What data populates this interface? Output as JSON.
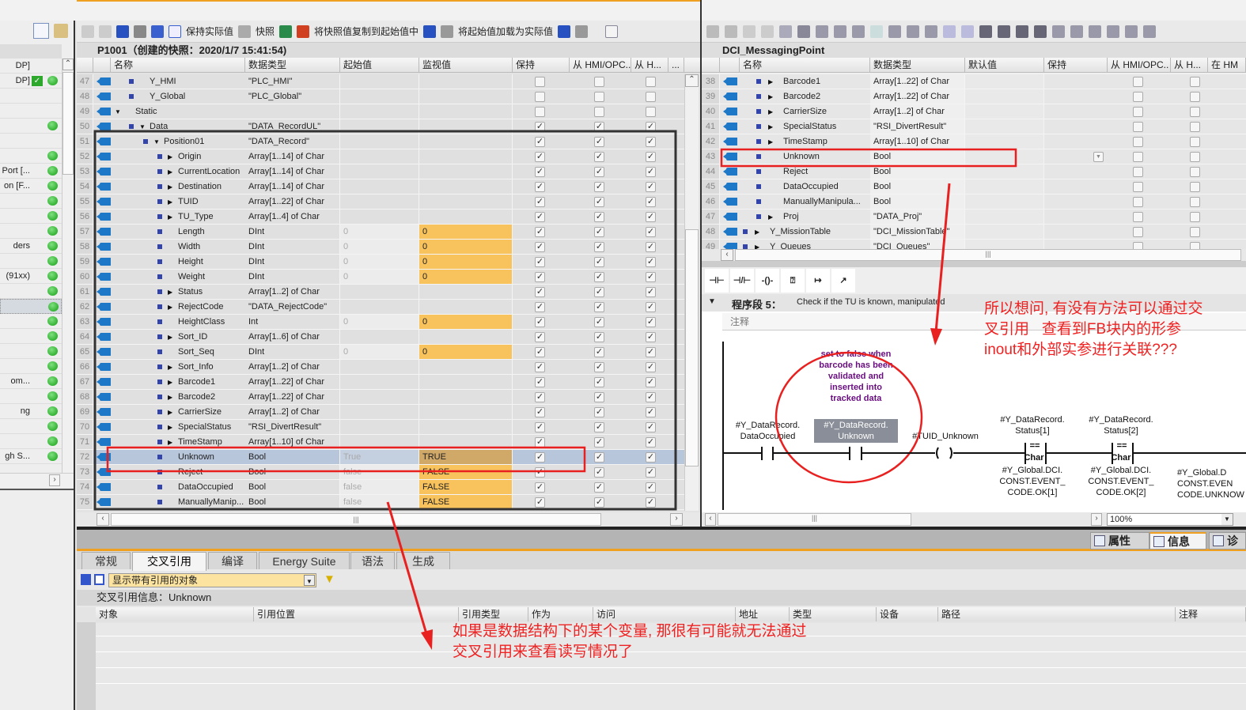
{
  "sidebar": {
    "rows": [
      {
        "text": "DP]",
        "dot": false,
        "check": false
      },
      {
        "text": "DP]",
        "dot": true,
        "check": true
      },
      {
        "text": "",
        "dot": false
      },
      {
        "text": "",
        "dot": false
      },
      {
        "text": "",
        "dot": true
      },
      {
        "text": "",
        "dot": false
      },
      {
        "text": "",
        "dot": true
      },
      {
        "text": "Port [...",
        "dot": true
      },
      {
        "text": "on [F...",
        "dot": true
      },
      {
        "text": "",
        "dot": true
      },
      {
        "text": "",
        "dot": true
      },
      {
        "text": "",
        "dot": true
      },
      {
        "text": "ders",
        "dot": true
      },
      {
        "text": "",
        "dot": true
      },
      {
        "text": "(91xx)",
        "dot": true
      },
      {
        "text": "",
        "dot": true
      },
      {
        "text": "",
        "dot": true,
        "selected": true
      },
      {
        "text": "",
        "dot": true
      },
      {
        "text": "",
        "dot": true
      },
      {
        "text": "",
        "dot": true
      },
      {
        "text": "",
        "dot": true
      },
      {
        "text": "om...",
        "dot": true
      },
      {
        "text": "",
        "dot": true
      },
      {
        "text": "ng",
        "dot": true
      },
      {
        "text": "",
        "dot": true
      },
      {
        "text": "",
        "dot": true
      },
      {
        "text": "gh S...",
        "dot": true
      }
    ]
  },
  "left_editor": {
    "toolbar": {
      "keep_actual": "保持实际值",
      "snapshot": "快照",
      "copy_snapshot": "将快照值复制到起始值中",
      "load_start": "将起始值加载为实际值"
    },
    "title": "P1001（创建的快照：2020/1/7 15:41:54)",
    "columns": [
      "名称",
      "数据类型",
      "起始值",
      "监视值",
      "保持",
      "从 HMI/OPC..",
      "从 H...",
      "..."
    ],
    "rows": [
      {
        "n": "47",
        "lvl": 1,
        "exp": "",
        "name": "Y_HMI",
        "type": "\"PLC_HMI\"",
        "start": "",
        "mon": "",
        "c": [
          0,
          0,
          0
        ]
      },
      {
        "n": "48",
        "lvl": 1,
        "exp": "",
        "name": "Y_Global",
        "type": "\"PLC_Global\"",
        "start": "",
        "mon": "",
        "c": [
          0,
          0,
          0
        ]
      },
      {
        "n": "49",
        "lvl": 0,
        "exp": "down",
        "name": "Static",
        "type": "",
        "start": "",
        "mon": "",
        "c": [
          0,
          0,
          0
        ],
        "nosq": true
      },
      {
        "n": "50",
        "lvl": 1,
        "exp": "down",
        "name": "Data",
        "type": "\"DATA_RecordUL\"",
        "start": "",
        "mon": "",
        "c": [
          1,
          1,
          1
        ]
      },
      {
        "n": "51",
        "lvl": 2,
        "exp": "down",
        "name": "Position01",
        "type": "\"DATA_Record\"",
        "start": "",
        "mon": "",
        "c": [
          1,
          1,
          1
        ]
      },
      {
        "n": "52",
        "lvl": 3,
        "exp": "right",
        "name": "Origin",
        "type": "Array[1..14] of Char",
        "start": "",
        "mon": "",
        "c": [
          1,
          1,
          1
        ]
      },
      {
        "n": "53",
        "lvl": 3,
        "exp": "right",
        "name": "CurrentLocation",
        "type": "Array[1..14] of Char",
        "start": "",
        "mon": "",
        "c": [
          1,
          1,
          1
        ]
      },
      {
        "n": "54",
        "lvl": 3,
        "exp": "right",
        "name": "Destination",
        "type": "Array[1..14] of Char",
        "start": "",
        "mon": "",
        "c": [
          1,
          1,
          1
        ]
      },
      {
        "n": "55",
        "lvl": 3,
        "exp": "right",
        "name": "TUID",
        "type": "Array[1..22] of Char",
        "start": "",
        "mon": "",
        "c": [
          1,
          1,
          1
        ]
      },
      {
        "n": "56",
        "lvl": 3,
        "exp": "right",
        "name": "TU_Type",
        "type": "Array[1..4] of Char",
        "start": "",
        "mon": "",
        "c": [
          1,
          1,
          1
        ]
      },
      {
        "n": "57",
        "lvl": 3,
        "exp": "",
        "name": "Length",
        "type": "DInt",
        "start": "0",
        "mon": "0",
        "c": [
          1,
          1,
          1
        ]
      },
      {
        "n": "58",
        "lvl": 3,
        "exp": "",
        "name": "Width",
        "type": "DInt",
        "start": "0",
        "mon": "0",
        "c": [
          1,
          1,
          1
        ]
      },
      {
        "n": "59",
        "lvl": 3,
        "exp": "",
        "name": "Height",
        "type": "DInt",
        "start": "0",
        "mon": "0",
        "c": [
          1,
          1,
          1
        ]
      },
      {
        "n": "60",
        "lvl": 3,
        "exp": "",
        "name": "Weight",
        "type": "DInt",
        "start": "0",
        "mon": "0",
        "c": [
          1,
          1,
          1
        ]
      },
      {
        "n": "61",
        "lvl": 3,
        "exp": "right",
        "name": "Status",
        "type": "Array[1..2] of Char",
        "start": "",
        "mon": "",
        "c": [
          1,
          1,
          1
        ]
      },
      {
        "n": "62",
        "lvl": 3,
        "exp": "right",
        "name": "RejectCode",
        "type": "\"DATA_RejectCode\"",
        "start": "",
        "mon": "",
        "c": [
          1,
          1,
          1
        ]
      },
      {
        "n": "63",
        "lvl": 3,
        "exp": "",
        "name": "HeightClass",
        "type": "Int",
        "start": "0",
        "mon": "0",
        "c": [
          1,
          1,
          1
        ]
      },
      {
        "n": "64",
        "lvl": 3,
        "exp": "right",
        "name": "Sort_ID",
        "type": "Array[1..6] of Char",
        "start": "",
        "mon": "",
        "c": [
          1,
          1,
          1
        ]
      },
      {
        "n": "65",
        "lvl": 3,
        "exp": "",
        "name": "Sort_Seq",
        "type": "DInt",
        "start": "0",
        "mon": "0",
        "c": [
          1,
          1,
          1
        ]
      },
      {
        "n": "66",
        "lvl": 3,
        "exp": "right",
        "name": "Sort_Info",
        "type": "Array[1..2] of Char",
        "start": "",
        "mon": "",
        "c": [
          1,
          1,
          1
        ]
      },
      {
        "n": "67",
        "lvl": 3,
        "exp": "right",
        "name": "Barcode1",
        "type": "Array[1..22] of Char",
        "start": "",
        "mon": "",
        "c": [
          1,
          1,
          1
        ]
      },
      {
        "n": "68",
        "lvl": 3,
        "exp": "right",
        "name": "Barcode2",
        "type": "Array[1..22] of Char",
        "start": "",
        "mon": "",
        "c": [
          1,
          1,
          1
        ]
      },
      {
        "n": "69",
        "lvl": 3,
        "exp": "right",
        "name": "CarrierSize",
        "type": "Array[1..2] of Char",
        "start": "",
        "mon": "",
        "c": [
          1,
          1,
          1
        ]
      },
      {
        "n": "70",
        "lvl": 3,
        "exp": "right",
        "name": "SpecialStatus",
        "type": "\"RSI_DivertResult\"",
        "start": "",
        "mon": "",
        "c": [
          1,
          1,
          1
        ]
      },
      {
        "n": "71",
        "lvl": 3,
        "exp": "right",
        "name": "TimeStamp",
        "type": "Array[1..10] of Char",
        "start": "",
        "mon": "",
        "c": [
          1,
          1,
          1
        ]
      },
      {
        "n": "72",
        "lvl": 3,
        "exp": "",
        "name": "Unknown",
        "type": "Bool",
        "start": "True",
        "mon": "TRUE",
        "c": [
          1,
          1,
          1
        ],
        "selected": true
      },
      {
        "n": "73",
        "lvl": 3,
        "exp": "",
        "name": "Reject",
        "type": "Bool",
        "start": "false",
        "mon": "FALSE",
        "c": [
          1,
          1,
          1
        ]
      },
      {
        "n": "74",
        "lvl": 3,
        "exp": "",
        "name": "DataOccupied",
        "type": "Bool",
        "start": "false",
        "mon": "FALSE",
        "c": [
          1,
          1,
          1
        ]
      },
      {
        "n": "75",
        "lvl": 3,
        "exp": "",
        "name": "ManuallyManip...",
        "type": "Bool",
        "start": "false",
        "mon": "FALSE",
        "c": [
          1,
          1,
          1
        ]
      }
    ]
  },
  "right_editor": {
    "title": "DCI_MessagingPoint",
    "columns": [
      "名称",
      "数据类型",
      "默认值",
      "保持",
      "从 HMI/OPC..",
      "从 H...",
      "在 HM"
    ],
    "rows": [
      {
        "n": "38",
        "lvl": 1,
        "exp": "right",
        "name": "Barcode1",
        "type": "Array[1..22] of Char"
      },
      {
        "n": "39",
        "lvl": 1,
        "exp": "right",
        "name": "Barcode2",
        "type": "Array[1..22] of Char"
      },
      {
        "n": "40",
        "lvl": 1,
        "exp": "right",
        "name": "CarrierSize",
        "type": "Array[1..2] of Char"
      },
      {
        "n": "41",
        "lvl": 1,
        "exp": "right",
        "name": "SpecialStatus",
        "type": "\"RSI_DivertResult\""
      },
      {
        "n": "42",
        "lvl": 1,
        "exp": "right",
        "name": "TimeStamp",
        "type": "Array[1..10] of Char"
      },
      {
        "n": "43",
        "lvl": 1,
        "exp": "",
        "name": "Unknown",
        "type": "Bool",
        "dropdown": true
      },
      {
        "n": "44",
        "lvl": 1,
        "exp": "",
        "name": "Reject",
        "type": "Bool"
      },
      {
        "n": "45",
        "lvl": 1,
        "exp": "",
        "name": "DataOccupied",
        "type": "Bool"
      },
      {
        "n": "46",
        "lvl": 1,
        "exp": "",
        "name": "ManuallyManipula...",
        "type": "Bool"
      },
      {
        "n": "47",
        "lvl": 1,
        "exp": "right",
        "name": "Proj",
        "type": "\"DATA_Proj\""
      },
      {
        "n": "48",
        "lvl": 0,
        "exp": "right",
        "name": "Y_MissionTable",
        "type": "\"DCI_MissionTable\""
      },
      {
        "n": "49",
        "lvl": 0,
        "exp": "right",
        "name": "Y_Queues",
        "type": "\"DCI_Queues\""
      }
    ],
    "network": {
      "label": "程序段 5：",
      "title": "Check if the TU is known, manipulated",
      "comment": "注释"
    },
    "ladder": {
      "comment_block": "set to false when barcode has been validated and inserted into tracked data",
      "contact1": "#Y_DataRecord.\nDataOccupied",
      "contact2": "#Y_DataRecord.\nUnknown",
      "coil": "#TUID_Unknown",
      "cmp1_top": "#Y_DataRecord.\nStatus[1]",
      "cmp1_op": "==",
      "cmp1_type": "Char",
      "cmp1_bottom": "#Y_Global.DCI.\nCONST.EVENT_\nCODE.OK[1]",
      "cmp2_top": "#Y_DataRecord.\nStatus[2]",
      "cmp2_op": "==",
      "cmp2_type": "Char",
      "cmp2_bottom": "#Y_Global.DCI.\nCONST.EVENT_\nCODE.OK[2]",
      "cmp3_bottom": "#Y_Global.D\nCONST.EVEN\nCODE.UNKNOW"
    },
    "zoom": "100%"
  },
  "inspector_tabs": [
    {
      "label": "属性",
      "icon": "properties-icon"
    },
    {
      "label": "信息",
      "icon": "info-icon",
      "active": true
    },
    {
      "label": "诊",
      "icon": "diagnostics-icon"
    }
  ],
  "bottom": {
    "tabs": [
      {
        "label": "常规"
      },
      {
        "label": "交叉引用",
        "active": true
      },
      {
        "label": "编译"
      },
      {
        "label": "Energy Suite"
      },
      {
        "label": "语法"
      },
      {
        "label": "生成"
      }
    ],
    "filter": "显示带有引用的对象",
    "info_title": "交叉引用信息：Unknown",
    "columns": [
      "对象",
      "引用位置",
      "引用类型",
      "作为",
      "访问",
      "地址",
      "类型",
      "设备",
      "路径",
      "注释"
    ]
  },
  "annotations": {
    "right_note": "所以想问, 有没有方法可以通过交\n叉引用   查看到FB块内的形参\ninout和外部实参进行关联???",
    "bottom_note": "如果是数据结构下的某个变量, 那很有可能就无法通过\n交叉引用来查看读写情况了",
    "color": "#ee2222"
  },
  "colors": {
    "monitor": "#f8c25c",
    "accent": "#f0a020",
    "selection": "#b8c6dc"
  }
}
